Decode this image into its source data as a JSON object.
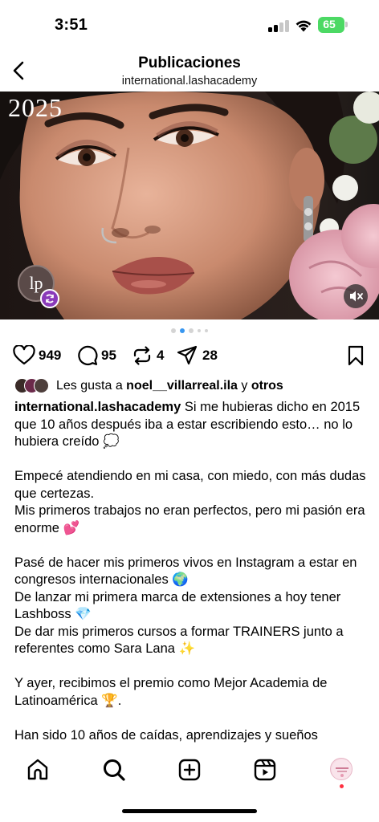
{
  "status_bar": {
    "time": "3:51",
    "battery": "65",
    "battery_color": "#4cd964"
  },
  "header": {
    "title": "Publicaciones",
    "subtitle": "international.lashacademy",
    "back_icon": "chevron-left-icon"
  },
  "post": {
    "image_overlay_text": "2025",
    "logo_text": "lp",
    "carousel": {
      "total": 5,
      "active_index": 1
    },
    "actions": {
      "likes": "949",
      "comments": "95",
      "reposts": "4",
      "shares": "28"
    },
    "liked_by": {
      "prefix": "Les gusta a ",
      "user": "noel__villarreal.ila",
      "middle": " y ",
      "others": "otros"
    },
    "caption": {
      "username": "international.lashacademy",
      "first_line": " Si me hubieras dicho en 2015 que 10 años después iba a estar escribiendo esto… no lo hubiera creído 💭",
      "paragraphs": [
        [
          "Empecé atendiendo en mi casa, con miedo, con más dudas que certezas.",
          "Mis primeros trabajos no eran perfectos, pero mi pasión era enorme 💕"
        ],
        [
          "Pasé de hacer mis primeros vivos en Instagram a estar en congresos internacionales 🌍",
          "De lanzar mi primera marca de extensiones a hoy tener Lashboss 💎",
          "De dar mis primeros cursos a formar TRAINERS junto a referentes como Sara Lana ✨"
        ],
        [
          "Y ayer, recibimos el premio como Mejor Academia de Latinoamérica 🏆."
        ],
        [
          "Han sido 10 años de caídas, aprendizajes y sueños"
        ]
      ]
    }
  },
  "bottom_nav": {
    "items": [
      "home-icon",
      "search-icon",
      "create-icon",
      "reels-icon",
      "profile-avatar"
    ],
    "notification_color": "#ff3040"
  },
  "colors": {
    "accent_blue": "#3897f0",
    "repost_badge": "#8a3ab9"
  }
}
